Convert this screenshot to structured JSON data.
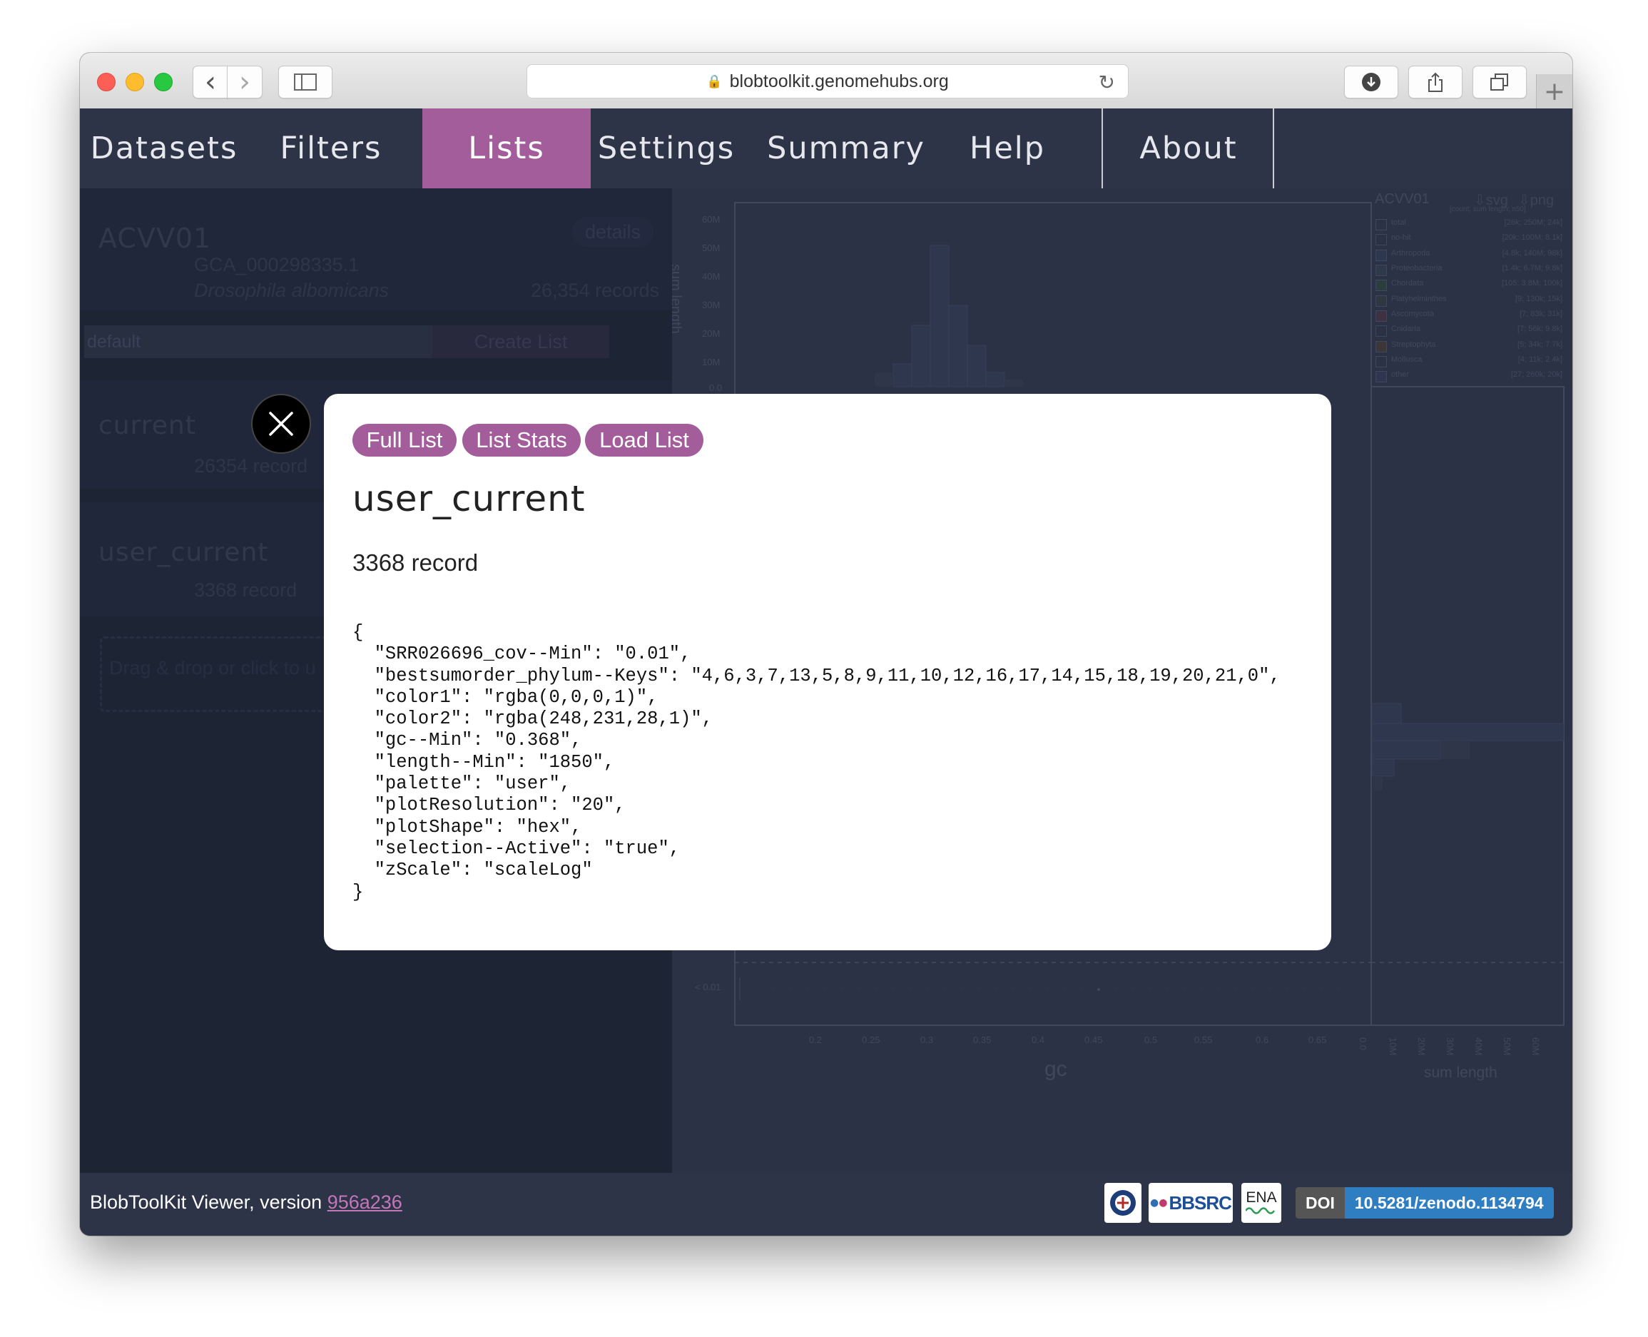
{
  "browser": {
    "url": "blobtoolkit.genomehubs.org",
    "lock_icon": "lock-icon",
    "reload_icon": "reload-icon",
    "back_glyph": "‹",
    "forward_glyph": "›",
    "new_tab_glyph": "+"
  },
  "nav": {
    "items": [
      "Datasets",
      "Filters",
      "Lists",
      "Settings",
      "Summary",
      "Help",
      "About"
    ],
    "active": "Lists",
    "accent": "#a25d9a"
  },
  "sidebar": {
    "dataset_name": "ACVV01",
    "details_label": "details",
    "accession": "GCA_000298335.1",
    "species": "Drosophila albomicans",
    "record_count": "26,354 records",
    "list_name_value": "default",
    "create_list_label": "Create List",
    "lists": [
      {
        "name": "current",
        "records": "26354 record"
      },
      {
        "name": "user_current",
        "records": "3368 record"
      }
    ],
    "dropzone_text": "Drag & drop or click to u"
  },
  "plot": {
    "legend_title": "ACVV01",
    "download_svg": "⇩svg",
    "download_png": "⇩png",
    "legend_header": "[count; sum length; n50]",
    "legend": [
      {
        "name": "total",
        "value": "[26k; 250M; 24k]"
      },
      {
        "name": "no-hit",
        "value": "[20k; 100M; 8.1k]"
      },
      {
        "name": "Arthropoda",
        "value": "[4.8k; 140M; 98k]"
      },
      {
        "name": "Proteobacteria",
        "value": "[1.4k; 6.7M; 9.8k]"
      },
      {
        "name": "Chordata",
        "value": "[105; 3.8M; 100k]"
      },
      {
        "name": "Platyhelminthes",
        "value": "[9; 130k; 15k]"
      },
      {
        "name": "Ascomycota",
        "value": "[7; 83k; 31k]"
      },
      {
        "name": "Cnidaria",
        "value": "[7; 56k; 9.8k]"
      },
      {
        "name": "Streptophyta",
        "value": "[5; 34k; 7.7k]"
      },
      {
        "name": "Mollusca",
        "value": "[4; 11k; 2.4k]"
      },
      {
        "name": "other",
        "value": "[27; 260k; 20k]"
      }
    ],
    "top_y_label": "sum length",
    "top_y_ticks": [
      "60M",
      "50M",
      "40M",
      "30M",
      "20M",
      "10M",
      "0.0"
    ],
    "low_label": "< 0.01",
    "gc_ticks": [
      "0.2",
      "0.25",
      "0.3",
      "0.35",
      "0.4",
      "0.45",
      "0.5",
      "0.55",
      "0.6",
      "0.65"
    ],
    "x_label": "gc",
    "side_ticks": [
      "0.0",
      "10M",
      "20M",
      "30M",
      "40M",
      "50M",
      "60M"
    ],
    "side_label": "sum length"
  },
  "modal": {
    "buttons": [
      "Full List",
      "List Stats",
      "Load List"
    ],
    "title": "user_current",
    "count": "3368 record",
    "json": "{\n  \"SRR026696_cov--Min\": \"0.01\",\n  \"bestsumorder_phylum--Keys\": \"4,6,3,7,13,5,8,9,11,10,12,16,17,14,15,18,19,20,21,0\",\n  \"color1\": \"rgba(0,0,0,1)\",\n  \"color2\": \"rgba(248,231,28,1)\",\n  \"gc--Min\": \"0.368\",\n  \"length--Min\": \"1850\",\n  \"palette\": \"user\",\n  \"plotResolution\": \"20\",\n  \"plotShape\": \"hex\",\n  \"selection--Active\": \"true\",\n  \"zScale\": \"scaleLog\"\n}",
    "close_icon": "close-icon"
  },
  "footer": {
    "text": "BlobToolKit Viewer, version ",
    "version": "956a236",
    "bbsrc_label": "BBSRC",
    "ena_label": "ENA",
    "doi_label": "DOI",
    "doi_value": "10.5281/zenodo.1134794"
  }
}
